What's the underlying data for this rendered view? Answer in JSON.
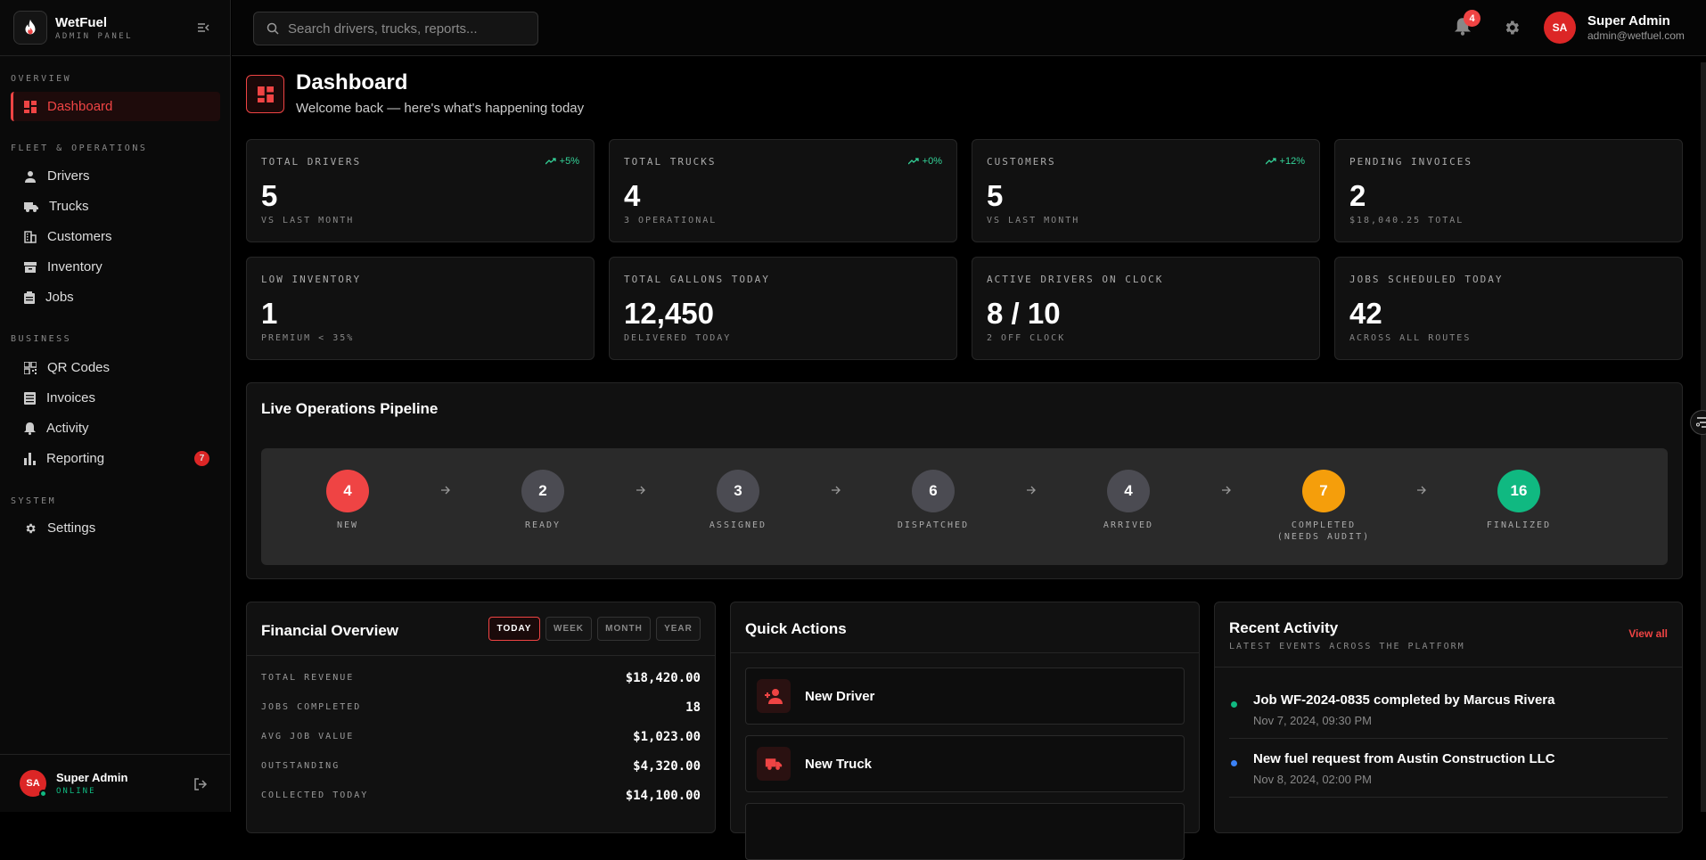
{
  "brand": {
    "name": "WetFuel",
    "sub": "ADMIN PANEL"
  },
  "nav": {
    "overview": "OVERVIEW",
    "fleet": "FLEET & OPERATIONS",
    "business": "BUSINESS",
    "system": "SYSTEM",
    "items": {
      "dashboard": "Dashboard",
      "drivers": "Drivers",
      "trucks": "Trucks",
      "customers": "Customers",
      "inventory": "Inventory",
      "jobs": "Jobs",
      "qr": "QR Codes",
      "invoices": "Invoices",
      "activity": "Activity",
      "reporting": "Reporting",
      "settings": "Settings"
    },
    "reporting_badge": "7"
  },
  "sidebar_user": {
    "initials": "SA",
    "name": "Super Admin",
    "status": "ONLINE"
  },
  "search": {
    "placeholder": "Search drivers, trucks, reports..."
  },
  "topbar": {
    "notif_count": "4",
    "user_initials": "SA",
    "user_name": "Super Admin",
    "user_email": "admin@wetfuel.com"
  },
  "page": {
    "title": "Dashboard",
    "subtitle": "Welcome back — here's what's happening today"
  },
  "stats": [
    {
      "label": "TOTAL DRIVERS",
      "value": "5",
      "sub": "VS LAST MONTH",
      "trend": "+5%"
    },
    {
      "label": "TOTAL TRUCKS",
      "value": "4",
      "sub": "3 OPERATIONAL",
      "trend": "+0%"
    },
    {
      "label": "CUSTOMERS",
      "value": "5",
      "sub": "VS LAST MONTH",
      "trend": "+12%"
    },
    {
      "label": "PENDING INVOICES",
      "value": "2",
      "sub": "$18,040.25 TOTAL",
      "trend": ""
    },
    {
      "label": "LOW INVENTORY",
      "value": "1",
      "sub": "PREMIUM < 35%",
      "trend": ""
    },
    {
      "label": "TOTAL GALLONS TODAY",
      "value": "12,450",
      "sub": "DELIVERED TODAY",
      "trend": ""
    },
    {
      "label": "ACTIVE DRIVERS ON CLOCK",
      "value": "8 / 10",
      "sub": "2 OFF CLOCK",
      "trend": ""
    },
    {
      "label": "JOBS SCHEDULED TODAY",
      "value": "42",
      "sub": "ACROSS ALL ROUTES",
      "trend": ""
    }
  ],
  "pipeline": {
    "title": "Live Operations Pipeline",
    "stages": [
      {
        "count": "4",
        "label": "NEW",
        "color": "#ef4444"
      },
      {
        "count": "2",
        "label": "READY",
        "color": "#4b4b52"
      },
      {
        "count": "3",
        "label": "ASSIGNED",
        "color": "#4b4b52"
      },
      {
        "count": "6",
        "label": "DISPATCHED",
        "color": "#4b4b52"
      },
      {
        "count": "4",
        "label": "ARRIVED",
        "color": "#4b4b52"
      },
      {
        "count": "7",
        "label": "COMPLETED",
        "label2": "(NEEDS AUDIT)",
        "color": "#f59e0b"
      },
      {
        "count": "16",
        "label": "FINALIZED",
        "color": "#10b981"
      }
    ]
  },
  "financial": {
    "title": "Financial Overview",
    "filters": [
      "TODAY",
      "WEEK",
      "MONTH",
      "YEAR"
    ],
    "rows": [
      {
        "k": "TOTAL REVENUE",
        "v": "$18,420.00"
      },
      {
        "k": "JOBS COMPLETED",
        "v": "18"
      },
      {
        "k": "AVG JOB VALUE",
        "v": "$1,023.00"
      },
      {
        "k": "OUTSTANDING",
        "v": "$4,320.00"
      },
      {
        "k": "COLLECTED TODAY",
        "v": "$14,100.00"
      }
    ]
  },
  "quick": {
    "title": "Quick Actions",
    "new_driver": "New Driver",
    "new_truck": "New Truck"
  },
  "activity": {
    "title": "Recent Activity",
    "sub": "LATEST EVENTS ACROSS THE PLATFORM",
    "view_all": "View all",
    "items": [
      {
        "text": "Job WF-2024-0835 completed by Marcus Rivera",
        "date": "Nov 7, 2024, 09:30 PM",
        "color": "#10b981"
      },
      {
        "text": "New fuel request from Austin Construction LLC",
        "date": "Nov 8, 2024, 02:00 PM",
        "color": "#3b82f6"
      }
    ]
  },
  "colors": {
    "accent": "#ef4444",
    "success": "#34d399",
    "bg": "#000000",
    "card": "#111111"
  }
}
